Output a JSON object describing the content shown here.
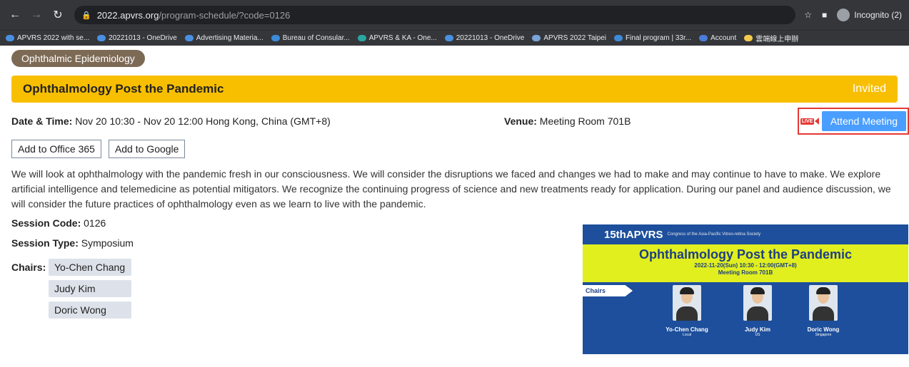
{
  "browser": {
    "url_host": "2022.apvrs.org",
    "url_path": "/program-schedule/?code=0126",
    "incognito_label": "Incognito (2)",
    "bookmarks": [
      {
        "label": "APVRS 2022 with se...",
        "color": "#4a90e2"
      },
      {
        "label": "20221013 - OneDrive",
        "color": "#4a90e2"
      },
      {
        "label": "Advertising Materia...",
        "color": "#4a90e2"
      },
      {
        "label": "Bureau of Consular...",
        "color": "#3c8bd9"
      },
      {
        "label": "APVRS & KA - One...",
        "color": "#2aa6a0"
      },
      {
        "label": "20221013 - OneDrive",
        "color": "#4a90e2"
      },
      {
        "label": "APVRS 2022 Taipei",
        "color": "#7aa3d9"
      },
      {
        "label": "Final program | 33r...",
        "color": "#3c8bd9"
      },
      {
        "label": "Account",
        "color": "#4a7dd9"
      },
      {
        "label": "雲端線上申辦",
        "color": "#f2c94c"
      }
    ]
  },
  "session": {
    "category": "Ophthalmic Epidemiology",
    "title": "Ophthalmology Post the Pandemic",
    "badge": "Invited",
    "datetime_label": "Date & Time:",
    "datetime_value": "Nov 20 10:30 - Nov 20 12:00 Hong Kong, China (GMT+8)",
    "venue_label": "Venue:",
    "venue_value": "Meeting Room 701B",
    "live_icon_text": "LIVE",
    "attend_label": "Attend Meeting",
    "add_office": "Add to Office 365",
    "add_google": "Add to Google",
    "description": "We will look at ophthalmology with the pandemic fresh in our consciousness. We will consider the disruptions we faced and changes we had to make and may continue to have to make. We explore artificial intelligence and telemedicine as potential mitigators. We recognize the continuing progress of science and new treatments ready for application. During our panel and audience discussion, we will consider the future practices of ophthalmology even as we learn to live with the pandemic.",
    "code_label": "Session Code:",
    "code_value": "0126",
    "type_label": "Session Type:",
    "type_value": "Symposium",
    "chairs_label": "Chairs:",
    "chairs": [
      "Yo-Chen Chang",
      "Judy Kim",
      "Doric Wong"
    ]
  },
  "poster": {
    "brand": "15thAPVRS",
    "brand_sub": "Congress of the Asia-Pacific Vitreo-retina Society",
    "title": "Ophthalmology Post the Pandemic",
    "date_line": "2022-11-20(Sun)  10:30 - 12:00(GMT+8)",
    "room_line": "Meeting Room 701B",
    "chairs_tag": "Chairs",
    "people": [
      {
        "name": "Yo-Chen Chang",
        "loc": "Local"
      },
      {
        "name": "Judy Kim",
        "loc": "US"
      },
      {
        "name": "Doric Wong",
        "loc": "Singapore"
      }
    ]
  }
}
